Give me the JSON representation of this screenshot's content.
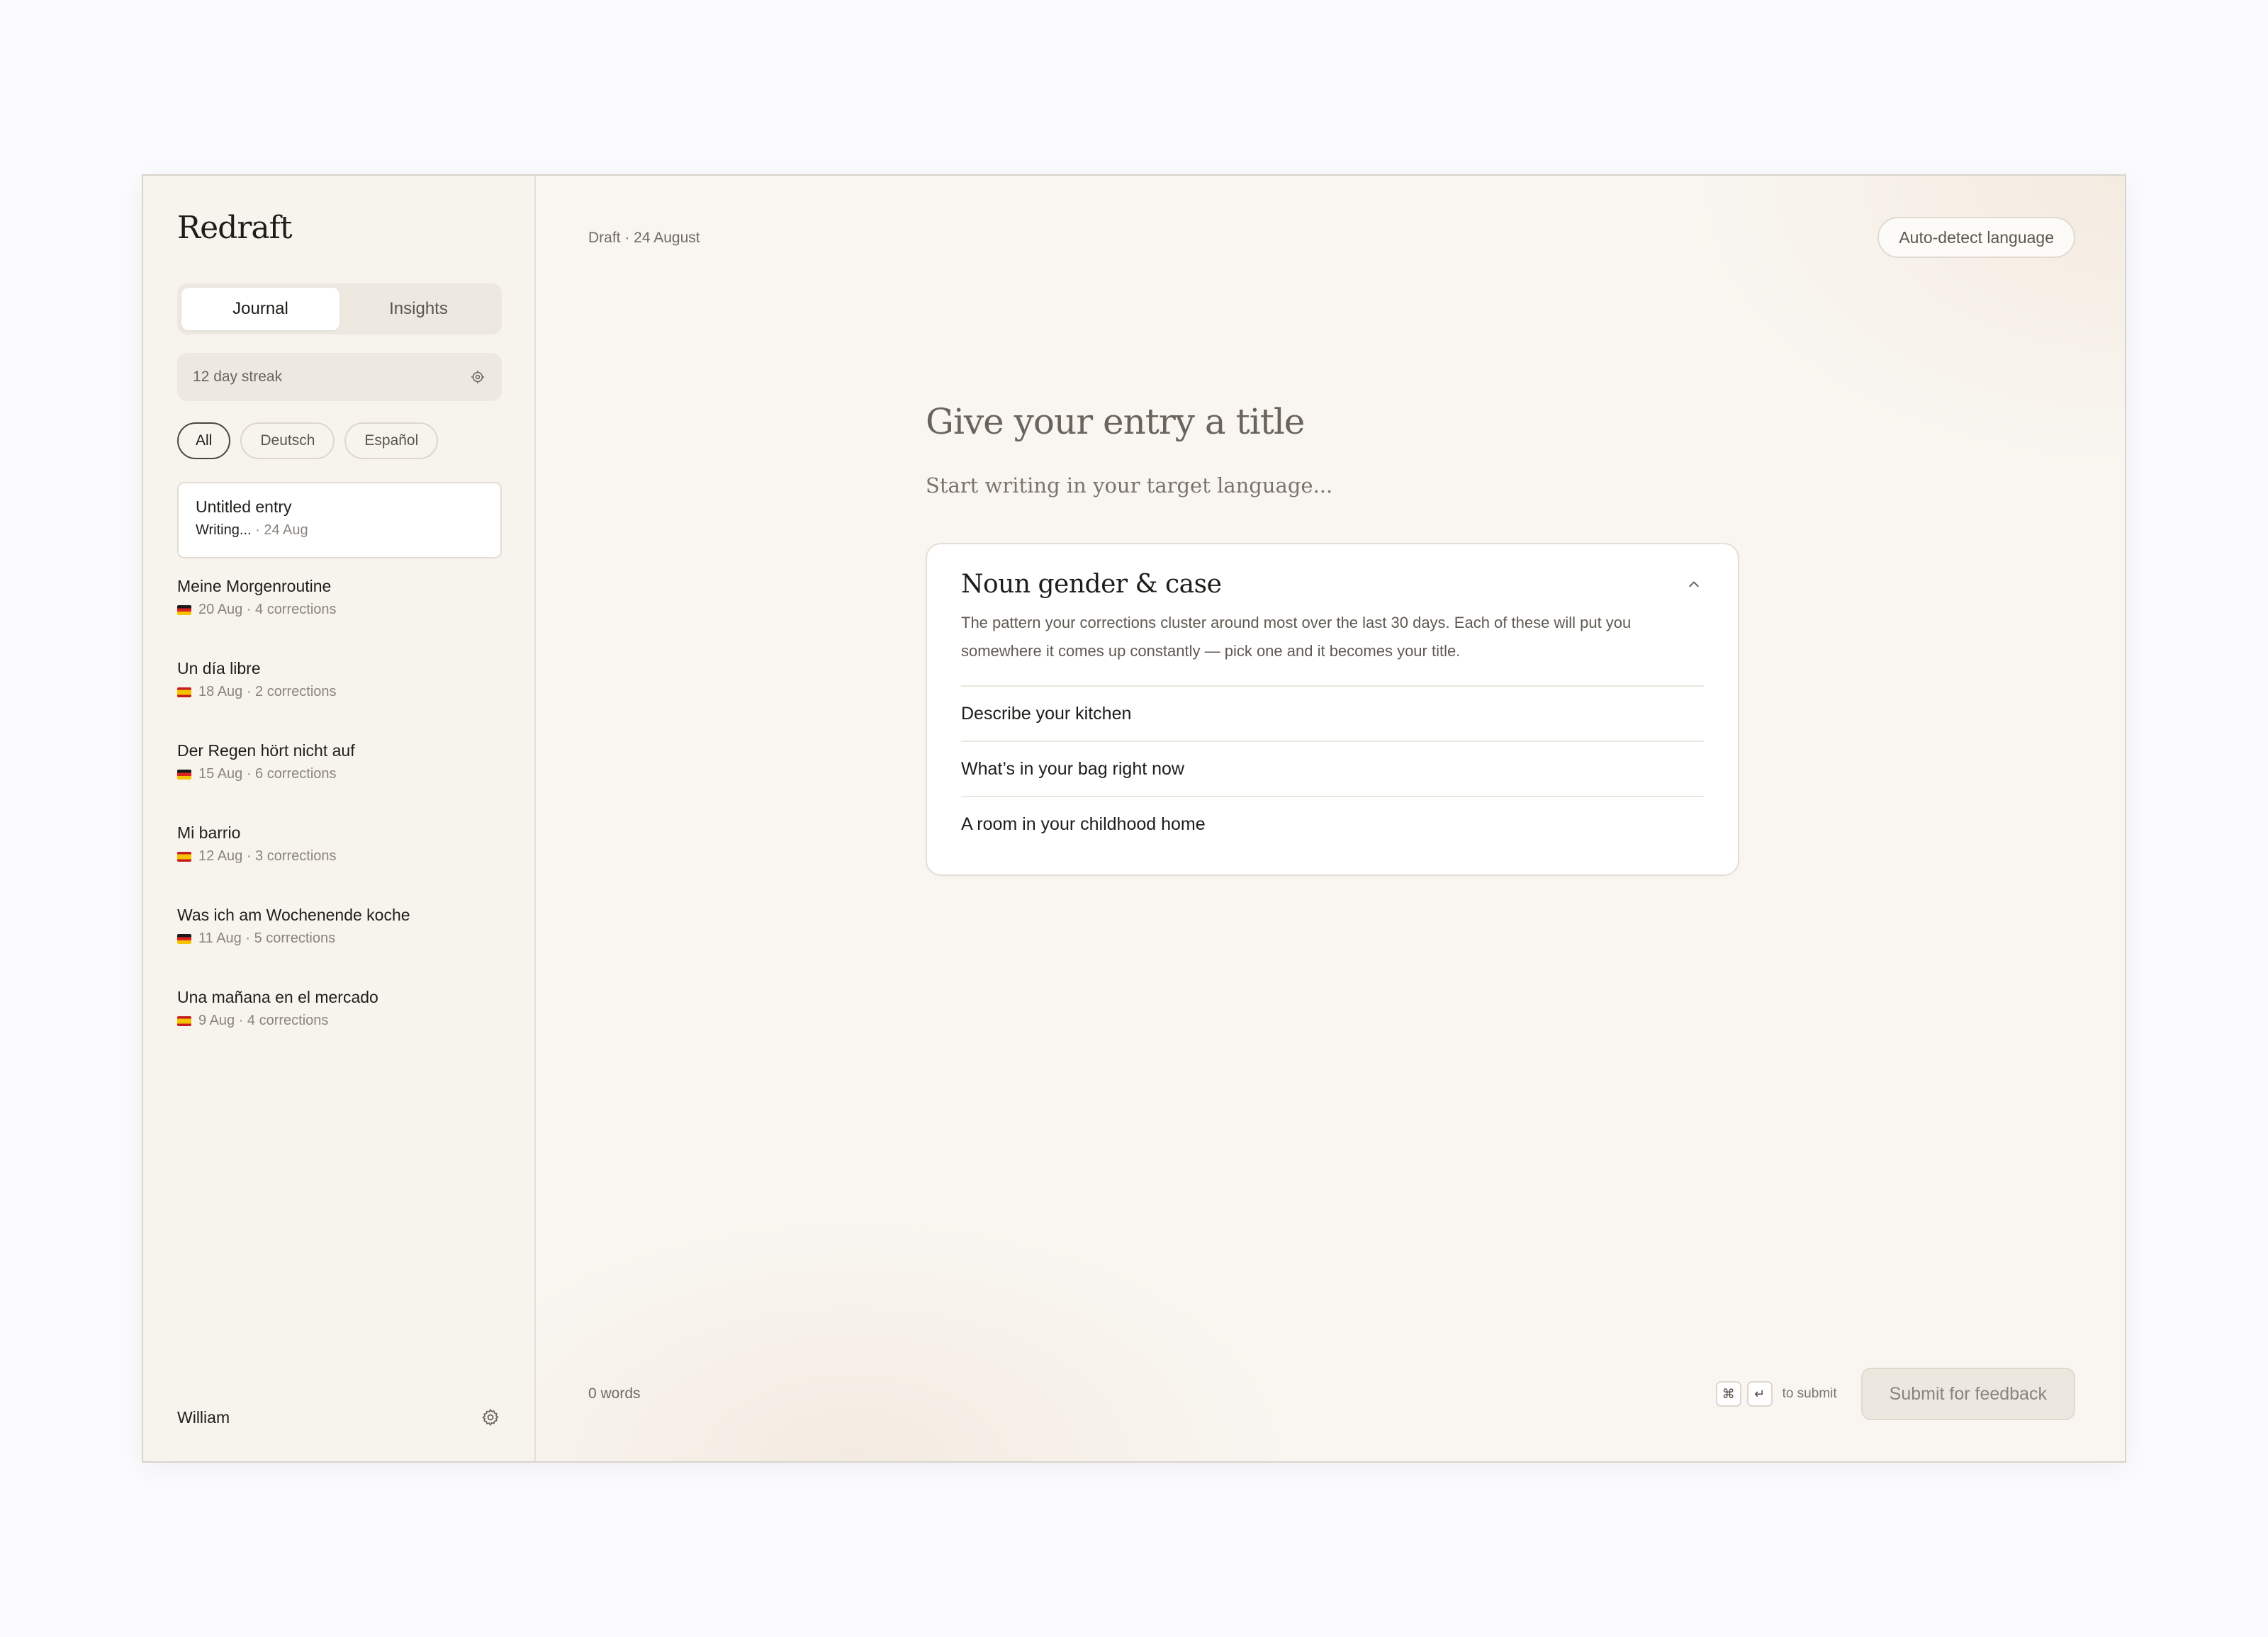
{
  "app": {
    "name": "Redraft"
  },
  "sidebar": {
    "tabs": [
      {
        "label": "Journal",
        "active": true
      },
      {
        "label": "Insights",
        "active": false
      }
    ],
    "streak": {
      "label": "12 day streak",
      "icon": "badge-icon"
    },
    "filters": [
      {
        "label": "All",
        "active": true
      },
      {
        "label": "Deutsch",
        "active": false
      },
      {
        "label": "Español",
        "active": false
      }
    ],
    "current_entry": {
      "title": "Untitled entry",
      "status": "Writing...",
      "date": "· 24 Aug"
    },
    "entries": [
      {
        "title": "Meine Morgenroutine",
        "flag": "de",
        "meta": "20 Aug · 4 corrections"
      },
      {
        "title": "Un día libre",
        "flag": "es",
        "meta": "18 Aug · 2 corrections"
      },
      {
        "title": "Der Regen hört nicht auf",
        "flag": "de",
        "meta": "15 Aug · 6 corrections"
      },
      {
        "title": "Mi barrio",
        "flag": "es",
        "meta": "12 Aug · 3 corrections"
      },
      {
        "title": "Was ich am Wochenende koche",
        "flag": "de",
        "meta": "11 Aug · 5 corrections"
      },
      {
        "title": "Una mañana en el mercado",
        "flag": "es",
        "meta": "9 Aug · 4 corrections"
      }
    ],
    "user": {
      "name": "William",
      "settings_icon": "gear-icon"
    }
  },
  "editor": {
    "draft_label": "Draft · 24 August",
    "language_button": "Auto-detect language",
    "title_placeholder": "Give your entry a title",
    "body_placeholder": "Start writing in your target language...",
    "prompt_card": {
      "title": "Noun gender & case",
      "description": "The pattern your corrections cluster around most over the last 30 days. Each of these will put you somewhere it comes up constantly — pick one and it becomes your title.",
      "suggestions": [
        "Describe your kitchen",
        "What’s in your bag right now",
        "A room in your childhood home"
      ],
      "collapse_icon": "chevron-up-icon"
    },
    "footer": {
      "word_count": "0 words",
      "kbd_cmd": "⌘",
      "kbd_enter": "↵",
      "kbd_hint": "to submit",
      "submit_label": "Submit for feedback"
    }
  },
  "colors": {
    "background": "#f8f5f0",
    "sidebar": "#f7f4ee",
    "accent_text": "#1f1d1a",
    "muted_text": "#8a857c"
  }
}
